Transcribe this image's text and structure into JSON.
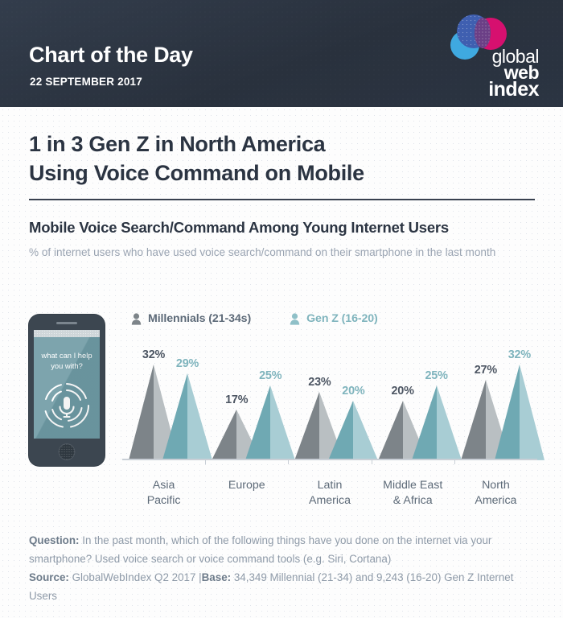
{
  "header": {
    "title": "Chart of the Day",
    "date": "22 SEPTEMBER 2017",
    "logo": {
      "line1": "global",
      "line2": "web",
      "line3": "index",
      "colors": {
        "blue": "#3f5fb0",
        "magenta": "#d6106f",
        "cyan": "#3fa9e0"
      }
    },
    "background_color": "#2b3442"
  },
  "main": {
    "title_line1": "1 in 3 Gen Z in North America",
    "title_line2": "Using Voice Command on Mobile",
    "subtitle": "Mobile Voice Search/Command Among Young Internet Users",
    "description": "% of internet users who have used voice search/command on their smartphone in the last month"
  },
  "phone": {
    "prompt_line1": "what can I help",
    "prompt_line2": "you with?",
    "screen_color": "#6e9aa4",
    "frame_color": "#3c4650"
  },
  "footer": {
    "question_label": "Question:",
    "question_text": " In the past month, which of the following things have you done on the internet via your smartphone? Used voice search or voice command tools (e.g. Siri, Cortana)",
    "source_label": "Source:",
    "source_text": " GlobalWebIndex Q2 2017 ",
    "separator": "|",
    "base_label": "Base:",
    "base_text": " 34,349 Millennial (21-34) and 9,243 (16-20) Gen Z Internet Users"
  },
  "chart_data": {
    "type": "bar",
    "title": "Mobile Voice Search/Command Among Young Internet Users",
    "subtitle": "% of internet users who have used voice search/command on their smartphone in the last month",
    "xlabel": "",
    "ylabel": "% of internet users",
    "ylim": [
      0,
      35
    ],
    "grid": false,
    "legend_position": "top-left",
    "marker_style": "triangle",
    "categories": [
      "Asia Pacific",
      "Europe",
      "Latin America",
      "Middle East & Africa",
      "North America"
    ],
    "category_lines": [
      [
        "Asia",
        "Pacific"
      ],
      [
        "Europe",
        ""
      ],
      [
        "Latin",
        "America"
      ],
      [
        "Middle East",
        "& Africa"
      ],
      [
        "North",
        "America"
      ]
    ],
    "series": [
      {
        "name": "Millennials (21-34s)",
        "color": "#7d8489",
        "color_light": "#b9bfc2",
        "label_color": "#4d5663",
        "values": [
          32,
          17,
          23,
          20,
          27
        ],
        "value_labels": [
          "32%",
          "17%",
          "23%",
          "20%",
          "27%"
        ]
      },
      {
        "name": "Gen Z (16-20)",
        "color": "#6fa9b3",
        "color_light": "#a8cdd4",
        "label_color": "#7fb4bd",
        "values": [
          29,
          25,
          20,
          25,
          32
        ],
        "value_labels": [
          "29%",
          "25%",
          "20%",
          "25%",
          "32%"
        ]
      }
    ]
  }
}
